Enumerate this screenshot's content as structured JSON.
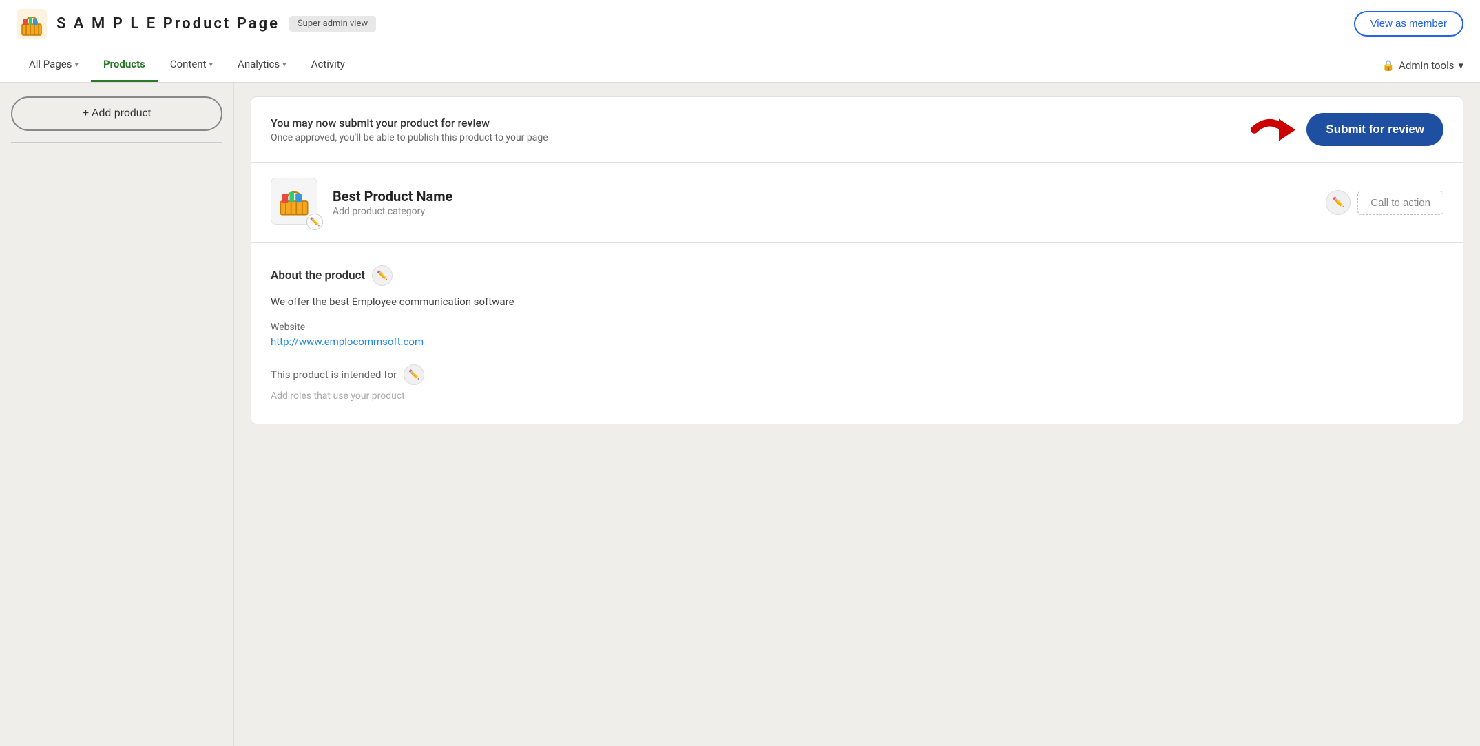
{
  "header": {
    "logo_alt": "basket-logo",
    "site_title": "S A M P L E  Product Page",
    "admin_badge": "Super admin view",
    "view_member_label": "View as member"
  },
  "nav": {
    "items": [
      {
        "id": "all-pages",
        "label": "All Pages",
        "has_chevron": true,
        "active": false
      },
      {
        "id": "products",
        "label": "Products",
        "has_chevron": false,
        "active": true
      },
      {
        "id": "content",
        "label": "Content",
        "has_chevron": true,
        "active": false
      },
      {
        "id": "analytics",
        "label": "Analytics",
        "has_chevron": true,
        "active": false
      },
      {
        "id": "activity",
        "label": "Activity",
        "has_chevron": false,
        "active": false
      }
    ],
    "admin_tools_label": "Admin tools"
  },
  "sidebar": {
    "add_product_label": "+ Add product"
  },
  "review_banner": {
    "title": "You may now submit your product for review",
    "subtitle": "Once approved, you'll be able to publish this product to your page",
    "button_label": "Submit for review"
  },
  "product": {
    "name": "Best Product Name",
    "category_placeholder": "Add product category",
    "cta_label": "Call to action",
    "about_title": "About the product",
    "description": "We offer the best Employee communication software",
    "website_label": "Website",
    "website_url": "http://www.emplocommsoft.com",
    "intended_label": "This product is intended for",
    "roles_placeholder": "Add roles that use your product"
  }
}
